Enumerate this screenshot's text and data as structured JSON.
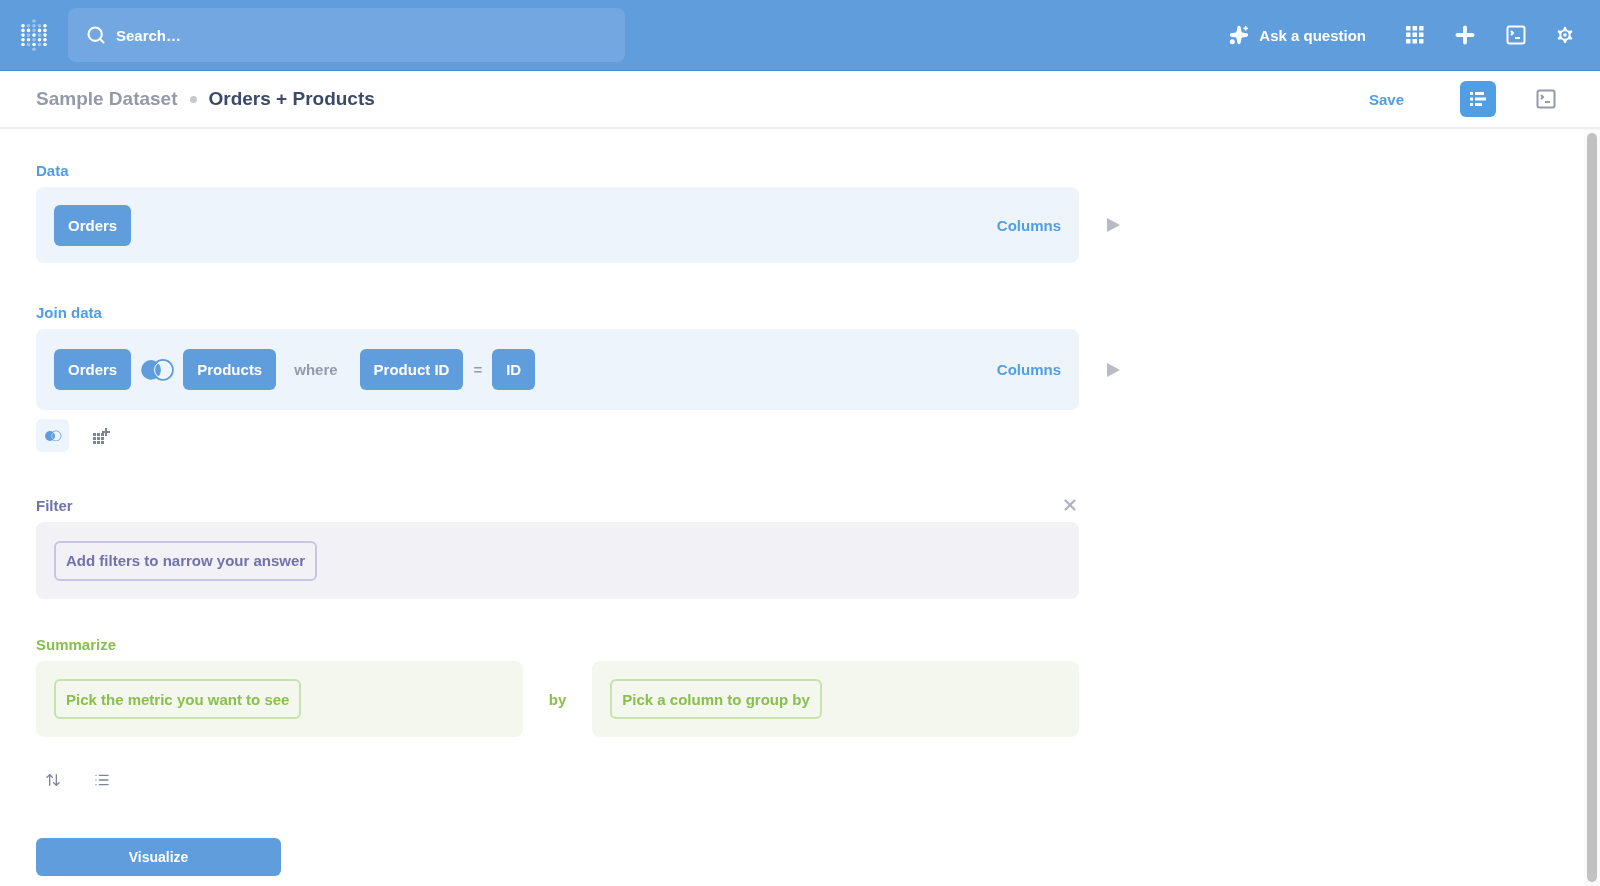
{
  "topbar": {
    "search": {
      "placeholder": "Search…"
    },
    "ask_button": "Ask a question"
  },
  "header": {
    "breadcrumb": [
      "Sample Dataset",
      "Orders + Products"
    ],
    "save": "Save",
    "views": [
      {
        "kind": "notebook",
        "selected": true
      },
      {
        "kind": "sql",
        "selected": false
      }
    ]
  },
  "steps": [
    {
      "kind": "data",
      "title": "Data",
      "table": "Orders",
      "columns_link": "Columns"
    },
    {
      "kind": "join",
      "title": "Join data",
      "left": "Orders",
      "right": "Products",
      "where": "where",
      "left_field": "Product ID",
      "operator": "=",
      "right_field": "ID",
      "columns_link": "Columns"
    },
    {
      "kind": "filter",
      "title": "Filter",
      "placeholder": "Add filters to narrow your answer"
    },
    {
      "kind": "summarize",
      "title": "Summarize",
      "metric_placeholder": "Pick the metric you want to see",
      "by": "by",
      "group_placeholder": "Pick a column to group by"
    }
  ],
  "visualize": "Visualize"
}
